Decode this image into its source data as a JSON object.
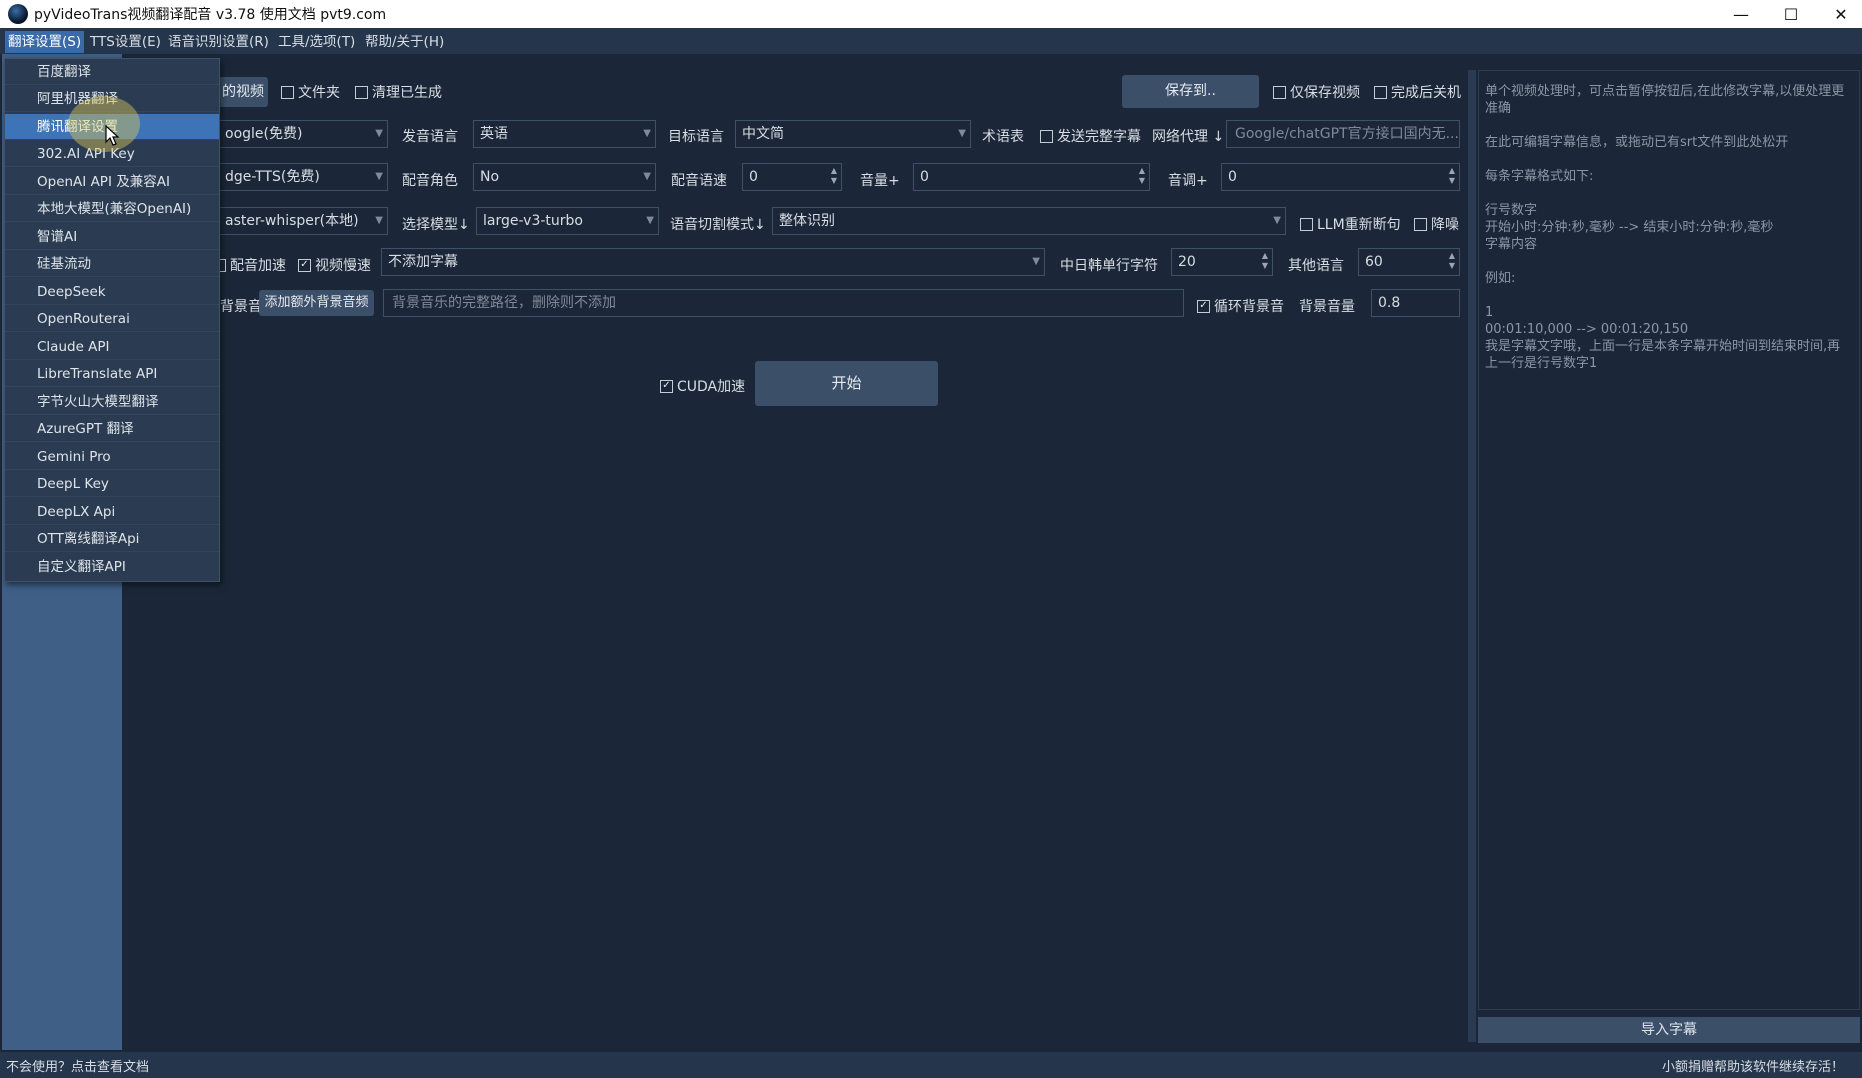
{
  "window": {
    "title": "pyVideoTrans视频翻译配音 v3.78  使用文档  pvt9.com",
    "controls": [
      "minimize-icon",
      "maximize-icon",
      "close-icon"
    ]
  },
  "menubar": {
    "items": [
      "翻译设置(S)",
      "TTS设置(E)",
      "语音识别设置(R)",
      "工具/选项(T)",
      "帮助/关于(H)"
    ]
  },
  "translate_menu": {
    "items": [
      "百度翻译",
      "阿里机器翻译",
      "腾讯翻译设置",
      "302.AI API Key",
      "OpenAI API 及兼容AI",
      "本地大模型(兼容OpenAI)",
      "智谱AI",
      "硅基流动",
      "DeepSeek",
      "OpenRouterai",
      "Claude API",
      "LibreTranslate API",
      "字节火山大模型翻译",
      "AzureGPT 翻译",
      "Gemini Pro",
      "DeepL Key",
      "DeepLX Api",
      "OTT离线翻译Api",
      "自定义翻译API"
    ],
    "selected_index": 2
  },
  "row1": {
    "select_video_label": "的视频",
    "folder_label": "文件夹",
    "clear_generated_label": "清理已生成",
    "save_to_label": "保存到..",
    "only_save_video_label": "仅保存视频",
    "shutdown_label": "完成后关机"
  },
  "row2": {
    "translate_channel": "oogle(免费)",
    "source_lang_label": "发音语言",
    "source_lang": "英语",
    "target_lang_label": "目标语言",
    "target_lang": "中文简",
    "glossary_label": "术语表",
    "send_full_sub_label": "发送完整字幕",
    "proxy_label": "网络代理",
    "proxy_placeholder": "Google/chatGPT官方接口国内无..."
  },
  "row3": {
    "tts_channel": "dge-TTS(免费)",
    "voice_role_label": "配音角色",
    "voice_role": "No",
    "speech_rate_label": "配音语速",
    "speech_rate": "0",
    "volume_label": "音量+",
    "volume": "0",
    "pitch_label": "音调+",
    "pitch": "0"
  },
  "row4": {
    "asr_channel": "aster-whisper(本地)",
    "model_label": "选择模型",
    "model": "large-v3-turbo",
    "split_mode_label": "语音切割模式",
    "split_mode": "整体识别",
    "llm_resegment_label": "LLM重新断句",
    "denoise_label": "降噪"
  },
  "row5": {
    "voice_speedup_label": "配音加速",
    "video_slowdown_label": "视频慢速",
    "subtitle_mode": "不添加字幕",
    "cjk_line_chars_label": "中日韩单行字符",
    "cjk_line_chars": "20",
    "other_lang_chars_label": "其他语言",
    "other_lang_chars": "60"
  },
  "row6": {
    "bg_label": "背景音",
    "add_bg_button": "添加额外背景音频",
    "bg_path_placeholder": "背景音乐的完整路径，删除则不添加",
    "loop_bg_label": "循环背景音",
    "bg_volume_label": "背景音量",
    "bg_volume": "0.8"
  },
  "actions": {
    "cuda_label": "CUDA加速",
    "start_button": "开始"
  },
  "subtitle_panel": {
    "hint": "单个视频处理时，可点击暂停按钮后,在此修改字幕,以便处理更准确\n\n在此可编辑字幕信息，或拖动已有srt文件到此处松开\n\n每条字幕格式如下:\n\n行号数字\n开始小时:分钟:秒,毫秒 --> 结束小时:分钟:秒,毫秒\n字幕内容\n\n例如:\n\n1\n00:01:10,000 --> 00:01:20,150\n我是字幕文字哦，上面一行是本条字幕开始时间到结束时间,再上一行是行号数字1",
    "import_button": "导入字幕"
  },
  "statusbar": {
    "left": "不会使用？点击查看文档",
    "right": "小额捐赠帮助该软件继续存活！"
  }
}
